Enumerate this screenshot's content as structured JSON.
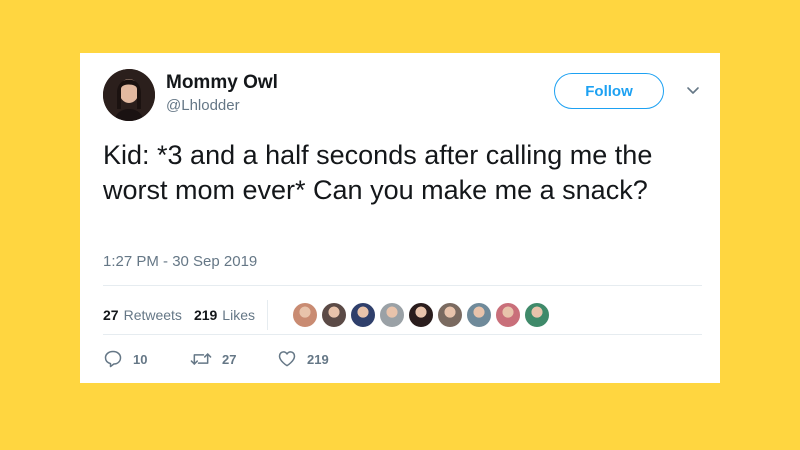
{
  "user": {
    "display_name": "Mommy Owl",
    "handle": "@Lhlodder",
    "avatar_icon": "profile-photo"
  },
  "follow_button": {
    "label": "Follow"
  },
  "menu_icon": "chevron-down-icon",
  "tweet": {
    "text": "Kid: *3 and a half seconds after calling me the worst mom ever* Can you make me a snack?",
    "timestamp": "1:27 PM - 30 Sep 2019"
  },
  "stats": {
    "retweets_count": "27",
    "retweets_label": "Retweets",
    "likes_count": "219",
    "likes_label": "Likes"
  },
  "liker_avatars": [
    {
      "icon": "liker-avatar",
      "color": "#c98b72"
    },
    {
      "icon": "liker-avatar",
      "color": "#5b4a46"
    },
    {
      "icon": "liker-avatar",
      "color": "#2f3f6b"
    },
    {
      "icon": "liker-avatar",
      "color": "#9aa1a6"
    },
    {
      "icon": "liker-avatar",
      "color": "#2a1d1d"
    },
    {
      "icon": "liker-avatar",
      "color": "#7a6a60"
    },
    {
      "icon": "liker-avatar",
      "color": "#6f8a9a"
    },
    {
      "icon": "liker-avatar",
      "color": "#c96f7a"
    },
    {
      "icon": "liker-avatar",
      "color": "#3f8a6a"
    }
  ],
  "actions": {
    "reply_count": "10",
    "retweet_count": "27",
    "like_count": "219"
  },
  "colors": {
    "background": "#FFD640",
    "accent": "#1da1f2",
    "muted": "#657786"
  }
}
